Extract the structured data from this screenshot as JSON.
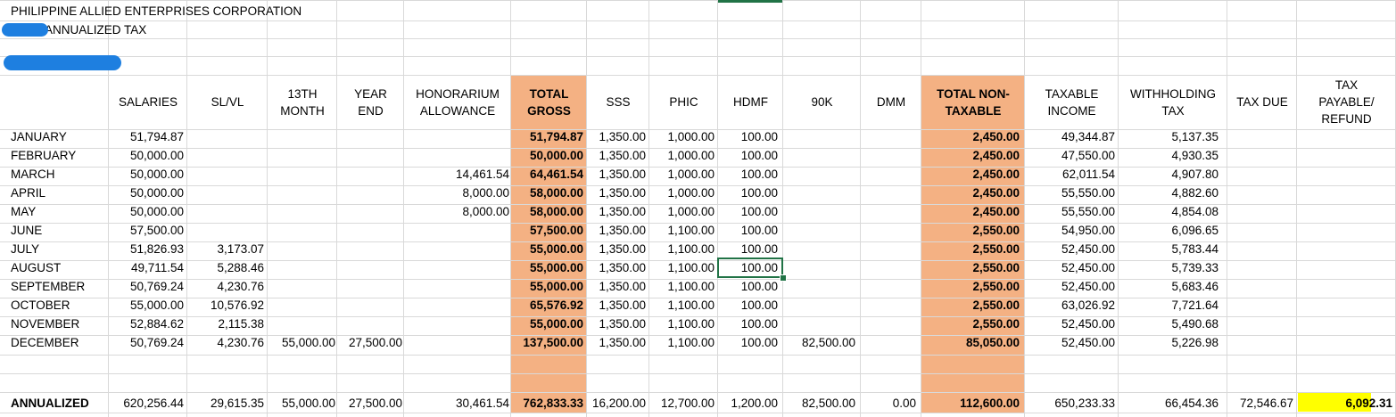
{
  "title": {
    "company": "PHILIPPINE ALLIED ENTERPRISES CORPORATION",
    "report": "ANNUALIZED TAX"
  },
  "colors": {
    "total_fill": "#f4b183",
    "refund_fill": "#ffff00",
    "selection": "#217346",
    "redaction": "#1e7fe0"
  },
  "headers": {
    "salaries": [
      "SALARIES"
    ],
    "slvl": [
      "SL/VL"
    ],
    "thirteenth": [
      "13TH",
      "MONTH"
    ],
    "yearend": [
      "YEAR",
      "END"
    ],
    "honorarium": [
      "HONORARIUM",
      "ALLOWANCE"
    ],
    "total_gross": [
      "TOTAL",
      "GROSS"
    ],
    "sss": [
      "SSS"
    ],
    "phic": [
      "PHIC"
    ],
    "hdmf": [
      "HDMF"
    ],
    "k90": [
      "90K"
    ],
    "dmm": [
      "DMM"
    ],
    "total_nontax": [
      "TOTAL NON-",
      "TAXABLE"
    ],
    "taxable": [
      "TAXABLE",
      "INCOME"
    ],
    "withholding": [
      "WITHHOLDING",
      "TAX"
    ],
    "taxdue": [
      "TAX DUE"
    ],
    "payable": [
      "TAX",
      "PAYABLE/",
      "REFUND"
    ]
  },
  "rows": [
    {
      "month": "JANUARY",
      "salaries": "51,794.87",
      "slvl": "",
      "thirteenth": "",
      "yearend": "",
      "honorarium": "",
      "total_gross": "51,794.87",
      "sss": "1,350.00",
      "phic": "1,000.00",
      "hdmf": "100.00",
      "k90": "",
      "dmm": "",
      "total_nontax": "2,450.00",
      "taxable": "49,344.87",
      "withholding": "5,137.35"
    },
    {
      "month": "FEBRUARY",
      "salaries": "50,000.00",
      "slvl": "",
      "thirteenth": "",
      "yearend": "",
      "honorarium": "",
      "total_gross": "50,000.00",
      "sss": "1,350.00",
      "phic": "1,000.00",
      "hdmf": "100.00",
      "k90": "",
      "dmm": "",
      "total_nontax": "2,450.00",
      "taxable": "47,550.00",
      "withholding": "4,930.35"
    },
    {
      "month": "MARCH",
      "salaries": "50,000.00",
      "slvl": "",
      "thirteenth": "",
      "yearend": "",
      "honorarium": "14,461.54",
      "total_gross": "64,461.54",
      "sss": "1,350.00",
      "phic": "1,000.00",
      "hdmf": "100.00",
      "k90": "",
      "dmm": "",
      "total_nontax": "2,450.00",
      "taxable": "62,011.54",
      "withholding": "4,907.80"
    },
    {
      "month": "APRIL",
      "salaries": "50,000.00",
      "slvl": "",
      "thirteenth": "",
      "yearend": "",
      "honorarium": "8,000.00",
      "total_gross": "58,000.00",
      "sss": "1,350.00",
      "phic": "1,000.00",
      "hdmf": "100.00",
      "k90": "",
      "dmm": "",
      "total_nontax": "2,450.00",
      "taxable": "55,550.00",
      "withholding": "4,882.60"
    },
    {
      "month": "MAY",
      "salaries": "50,000.00",
      "slvl": "",
      "thirteenth": "",
      "yearend": "",
      "honorarium": "8,000.00",
      "total_gross": "58,000.00",
      "sss": "1,350.00",
      "phic": "1,000.00",
      "hdmf": "100.00",
      "k90": "",
      "dmm": "",
      "total_nontax": "2,450.00",
      "taxable": "55,550.00",
      "withholding": "4,854.08"
    },
    {
      "month": "JUNE",
      "salaries": "57,500.00",
      "slvl": "",
      "thirteenth": "",
      "yearend": "",
      "honorarium": "",
      "total_gross": "57,500.00",
      "sss": "1,350.00",
      "phic": "1,100.00",
      "hdmf": "100.00",
      "k90": "",
      "dmm": "",
      "total_nontax": "2,550.00",
      "taxable": "54,950.00",
      "withholding": "6,096.65"
    },
    {
      "month": "JULY",
      "salaries": "51,826.93",
      "slvl": "3,173.07",
      "thirteenth": "",
      "yearend": "",
      "honorarium": "",
      "total_gross": "55,000.00",
      "sss": "1,350.00",
      "phic": "1,100.00",
      "hdmf": "100.00",
      "k90": "",
      "dmm": "",
      "total_nontax": "2,550.00",
      "taxable": "52,450.00",
      "withholding": "5,783.44"
    },
    {
      "month": "AUGUST",
      "salaries": "49,711.54",
      "slvl": "5,288.46",
      "thirteenth": "",
      "yearend": "",
      "honorarium": "",
      "total_gross": "55,000.00",
      "sss": "1,350.00",
      "phic": "1,100.00",
      "hdmf": "100.00",
      "k90": "",
      "dmm": "",
      "total_nontax": "2,550.00",
      "taxable": "52,450.00",
      "withholding": "5,739.33"
    },
    {
      "month": "SEPTEMBER",
      "salaries": "50,769.24",
      "slvl": "4,230.76",
      "thirteenth": "",
      "yearend": "",
      "honorarium": "",
      "total_gross": "55,000.00",
      "sss": "1,350.00",
      "phic": "1,100.00",
      "hdmf": "100.00",
      "k90": "",
      "dmm": "",
      "total_nontax": "2,550.00",
      "taxable": "52,450.00",
      "withholding": "5,683.46"
    },
    {
      "month": "OCTOBER",
      "salaries": "55,000.00",
      "slvl": "10,576.92",
      "thirteenth": "",
      "yearend": "",
      "honorarium": "",
      "total_gross": "65,576.92",
      "sss": "1,350.00",
      "phic": "1,100.00",
      "hdmf": "100.00",
      "k90": "",
      "dmm": "",
      "total_nontax": "2,550.00",
      "taxable": "63,026.92",
      "withholding": "7,721.64"
    },
    {
      "month": "NOVEMBER",
      "salaries": "52,884.62",
      "slvl": "2,115.38",
      "thirteenth": "",
      "yearend": "",
      "honorarium": "",
      "total_gross": "55,000.00",
      "sss": "1,350.00",
      "phic": "1,100.00",
      "hdmf": "100.00",
      "k90": "",
      "dmm": "",
      "total_nontax": "2,550.00",
      "taxable": "52,450.00",
      "withholding": "5,490.68"
    },
    {
      "month": "DECEMBER",
      "salaries": "50,769.24",
      "slvl": "4,230.76",
      "thirteenth": "55,000.00",
      "yearend": "27,500.00",
      "honorarium": "",
      "total_gross": "137,500.00",
      "sss": "1,350.00",
      "phic": "1,100.00",
      "hdmf": "100.00",
      "k90": "82,500.00",
      "dmm": "",
      "total_nontax": "85,050.00",
      "taxable": "52,450.00",
      "withholding": "5,226.98"
    }
  ],
  "annualized": {
    "label": "ANNUALIZED",
    "salaries": "620,256.44",
    "slvl": "29,615.35",
    "thirteenth": "55,000.00",
    "yearend": "27,500.00",
    "honorarium": "30,461.54",
    "total_gross": "762,833.33",
    "sss": "16,200.00",
    "phic": "12,700.00",
    "hdmf": "1,200.00",
    "k90": "82,500.00",
    "dmm": "0.00",
    "total_nontax": "112,600.00",
    "taxable": "650,233.33",
    "withholding": "66,454.36",
    "taxdue": "72,546.67",
    "payable": "6,092.31"
  }
}
